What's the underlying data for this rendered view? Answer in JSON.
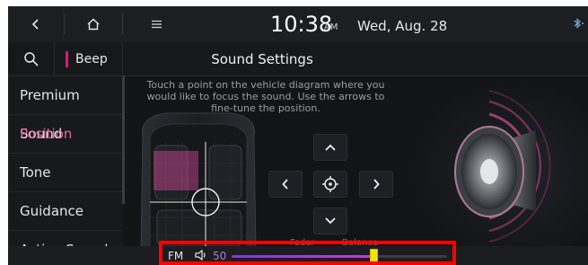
{
  "topbar": {
    "back_icon": "chevron-left-icon",
    "home_icon": "home-icon",
    "menu_icon": "hamburger-menu-icon",
    "time": "10:38",
    "ampm": "AM",
    "date": "Wed, Aug. 28",
    "status_icon": "bluetooth-status-icon"
  },
  "header": {
    "search_icon": "search-icon",
    "beep_label": "Beep",
    "title": "Sound Settings"
  },
  "sidebar": {
    "items": [
      {
        "label": "Premium Sound",
        "active": false
      },
      {
        "label": "Position",
        "active": true
      },
      {
        "label": "Tone",
        "active": false
      },
      {
        "label": "Guidance",
        "active": false
      },
      {
        "label": "Active Sound",
        "active": false
      }
    ]
  },
  "main": {
    "instructions": "Touch a point on the vehicle diagram where you would like to focus the sound. Use the arrows to fine-tune the position.",
    "controls": {
      "up_icon": "chevron-up-icon",
      "left_icon": "chevron-left-icon",
      "center_icon": "crosshair-target-icon",
      "right_icon": "chevron-right-icon",
      "down_icon": "chevron-down-icon",
      "fader_label": "Fader",
      "balance_label": "Balance"
    },
    "speaker_icon": "speaker-icon"
  },
  "bottombar": {
    "source": "FM",
    "volume_icon": "volume-icon",
    "volume_value": "50",
    "volume_level": 0.66
  },
  "colors": {
    "accent_pink": "#e06aa8",
    "beep_bar": "#e0177c",
    "volume_gradient_start": "#7b3bd6",
    "volume_gradient_end": "#c03fd0",
    "volume_thumb": "#f4e400",
    "highlight_box": "#ff0000"
  }
}
